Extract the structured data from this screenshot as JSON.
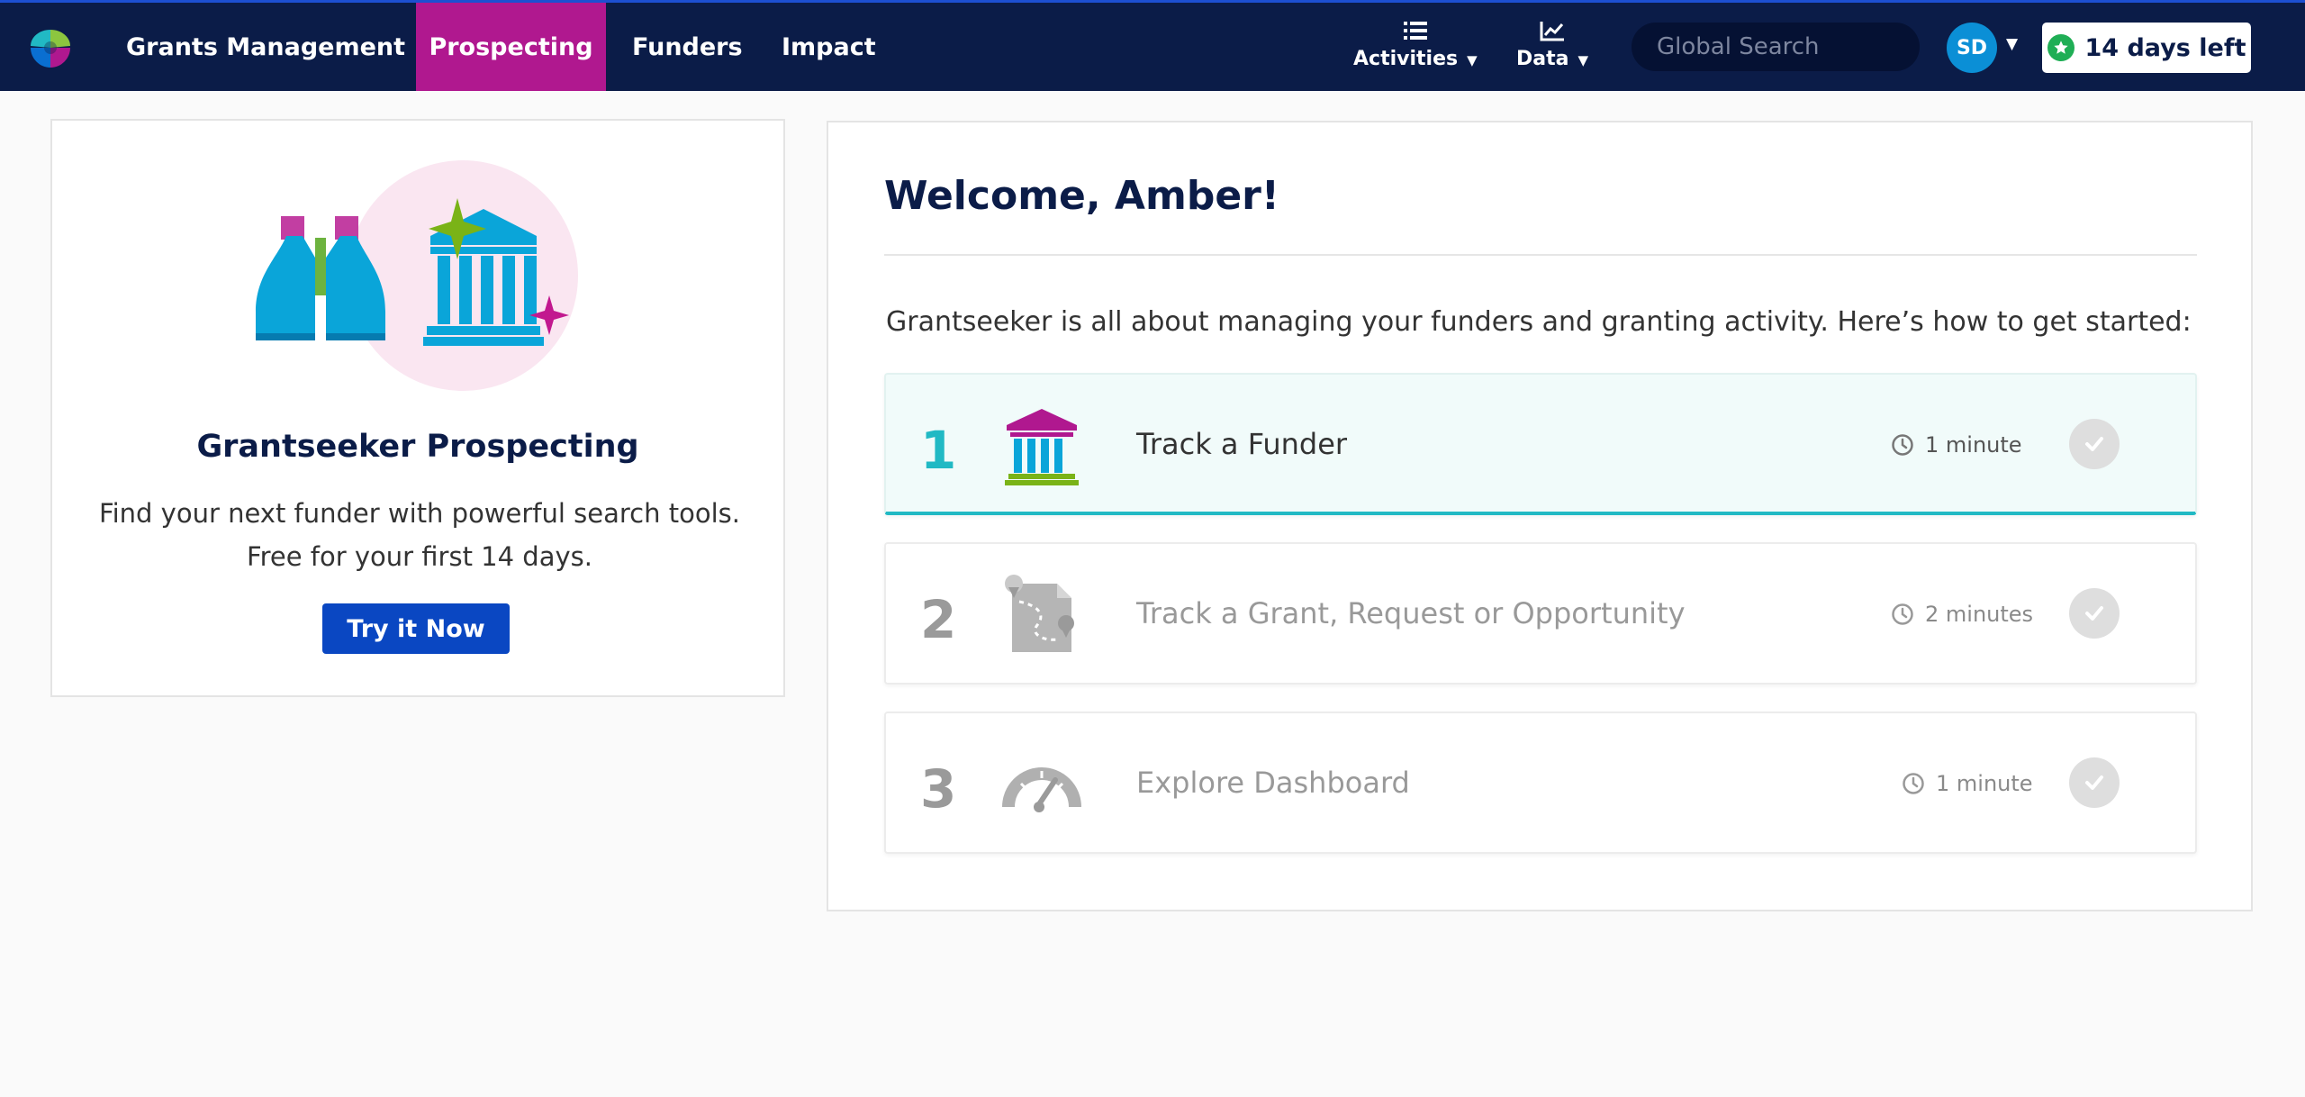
{
  "nav": {
    "grants_management": "Grants Management",
    "prospecting": "Prospecting",
    "funders": "Funders",
    "impact": "Impact",
    "activities": "Activities",
    "data": "Data",
    "search_placeholder": "Global Search",
    "avatar_initials": "SD",
    "trial_label": "14 days left"
  },
  "promo": {
    "title": "Grantseeker Prospecting",
    "line1": "Find your next funder with powerful search tools.",
    "line2": "Free for your first 14 days.",
    "button": "Try it Now",
    "illustration_icons": [
      "binoculars-icon",
      "bank-building-icon",
      "sparkle-icon"
    ]
  },
  "welcome": {
    "title": "Welcome, Amber!",
    "intro": "Grantseeker is all about managing your funders and granting activity. Here’s how to get started:",
    "steps": [
      {
        "number": "1",
        "label": "Track a Funder",
        "time": "1 minute",
        "icon": "bank-building-icon",
        "active": true
      },
      {
        "number": "2",
        "label": "Track a Grant, Request or Opportunity",
        "time": "2 minutes",
        "icon": "document-map-icon",
        "active": false
      },
      {
        "number": "3",
        "label": "Explore Dashboard",
        "time": "1 minute",
        "icon": "speedometer-icon",
        "active": false
      }
    ]
  },
  "colors": {
    "navbar": "#0b1c48",
    "active_nav": "#b0188f",
    "primary_button": "#0a47c2",
    "teal_accent": "#21b9c4",
    "trial_star": "#1fae55"
  }
}
